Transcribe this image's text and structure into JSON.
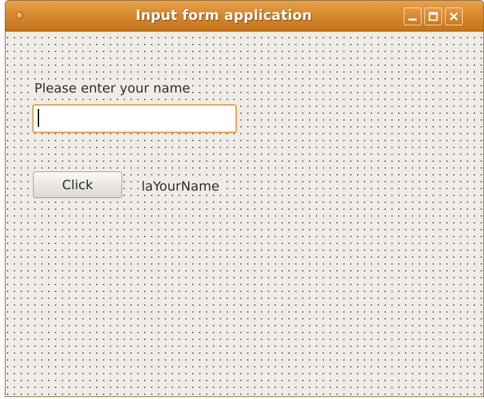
{
  "window": {
    "title": "Input form application",
    "controls": {
      "minimize_icon": "minimize-icon",
      "maximize_icon": "maximize-icon",
      "close_icon": "close-icon"
    },
    "colors": {
      "titlebar": "#d88a2e",
      "background": "#efebe7",
      "input_focus_border": "#e3a24a"
    }
  },
  "form": {
    "prompt_label": "Please enter your name",
    "name_input": {
      "value": "",
      "placeholder": ""
    },
    "click_button_label": "Click",
    "result_label": "laYourName"
  }
}
